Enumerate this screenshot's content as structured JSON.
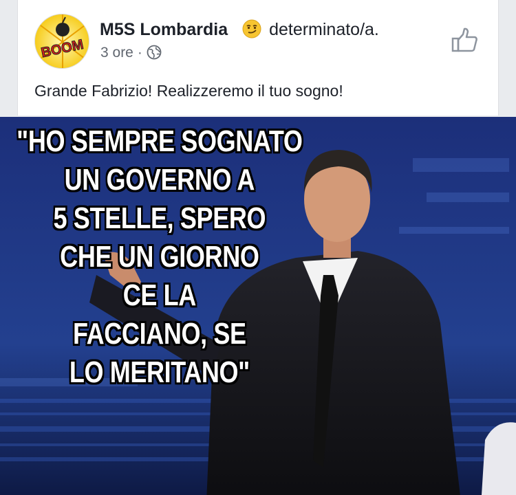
{
  "post": {
    "author": "M5S Lombardia",
    "feeling": "determinato/a.",
    "time": "3 ore",
    "separator": "·",
    "text": "Grande Fabrizio! Realizzeremo il tuo sogno!",
    "avatar_logo_text": "BOOM"
  },
  "image": {
    "quote_lines": [
      "\"HO SEMPRE SOGNATO",
      "UN GOVERNO A",
      "5 STELLE, SPERO",
      "CHE UN GIORNO",
      "CE LA",
      "FACCIANO, SE",
      "LO MERITANO\""
    ]
  },
  "colors": {
    "page_bg": "#e9ebee",
    "card_bg": "#ffffff",
    "photo_bg": "#1a2d6e",
    "author_text": "#1d2129",
    "meta_text": "#616770"
  }
}
